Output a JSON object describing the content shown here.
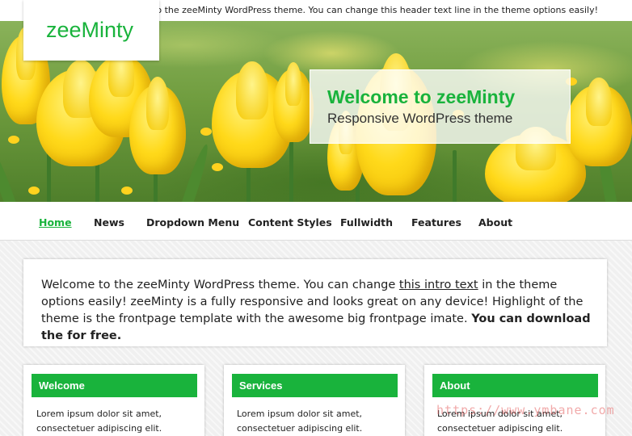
{
  "header": {
    "tagline": "Welcome to the zeeMinty WordPress theme. You can change this header text line in the theme options easily!",
    "logo": "zeeMinty"
  },
  "hero": {
    "title": "Welcome to zeeMinty",
    "subtitle": "Responsive WordPress theme"
  },
  "nav": {
    "items": [
      {
        "label": "Home"
      },
      {
        "label": "News"
      },
      {
        "label": "Dropdown Menu"
      },
      {
        "label": "Content Styles"
      },
      {
        "label": "Fullwidth"
      },
      {
        "label": "Features"
      },
      {
        "label": "About"
      }
    ],
    "active_index": 0
  },
  "intro": {
    "part1": "Welcome to the zeeMinty WordPress theme. You can change ",
    "link": "this intro text",
    "part2": " in the theme options easily! zeeMinty is a fully responsive and looks great on any device! Highlight of the theme is the frontpage template with the awesome big frontpage imate. ",
    "bold": "You can download the for free."
  },
  "widgets": [
    {
      "title": "Welcome",
      "text": "Lorem ipsum dolor sit amet, consectetuer adipiscing elit. Aenean commodo ligula"
    },
    {
      "title": "Services",
      "text": "Lorem ipsum dolor sit amet, consectetuer adipiscing elit. Aenean commodo ligula"
    },
    {
      "title": "About",
      "text": "Lorem ipsum dolor sit amet, consectetuer adipiscing elit. Aenean commodo ligula"
    }
  ],
  "watermark": "https://www.ymbane.com",
  "colors": {
    "accent": "#19b33c"
  }
}
